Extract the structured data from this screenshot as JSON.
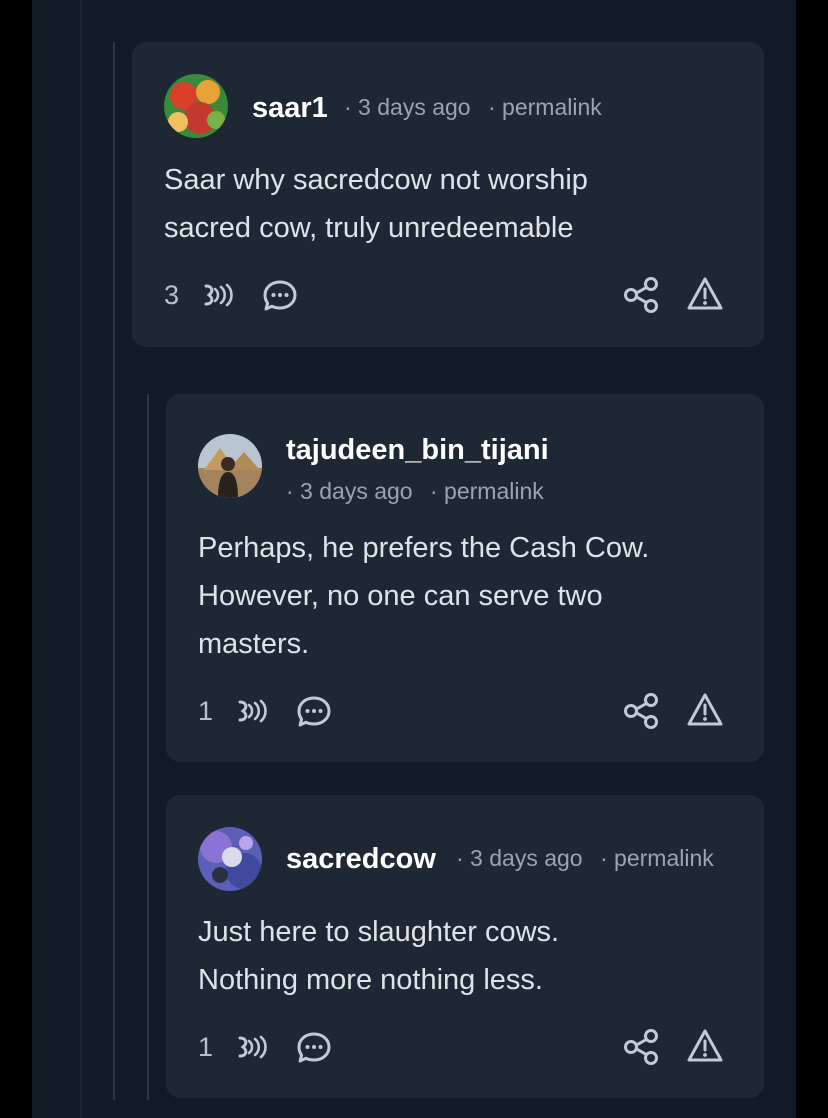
{
  "comments": [
    {
      "username": "saar1",
      "time": "· 3 days ago",
      "permalink": "· permalink",
      "text_lines": [
        "Saar why sacredcow not worship",
        "sacred cow, truly unredeemable"
      ],
      "score": "3"
    },
    {
      "username": "tajudeen_bin_tijani",
      "time": "· 3 days ago",
      "permalink": "· permalink",
      "text_lines": [
        "Perhaps, he prefers the Cash Cow.",
        "However, no one can serve two",
        "masters."
      ],
      "score": "1"
    },
    {
      "username": "sacredcow",
      "time": "· 3 days ago",
      "permalink": "· permalink",
      "text_lines": [
        "Just here to slaughter cows.",
        "Nothing more nothing less."
      ],
      "score": "1"
    }
  ],
  "icons": {
    "upvote": "signal-waves-icon",
    "reply": "chat-bubble-icon",
    "share": "share-icon",
    "report": "warning-triangle-icon"
  },
  "colors": {
    "background": "#111a27",
    "card": "#1e2734",
    "username": "#ffffff",
    "meta": "#9aa4b2",
    "body_text": "#dfe3e8",
    "icon": "#c3cad4"
  }
}
